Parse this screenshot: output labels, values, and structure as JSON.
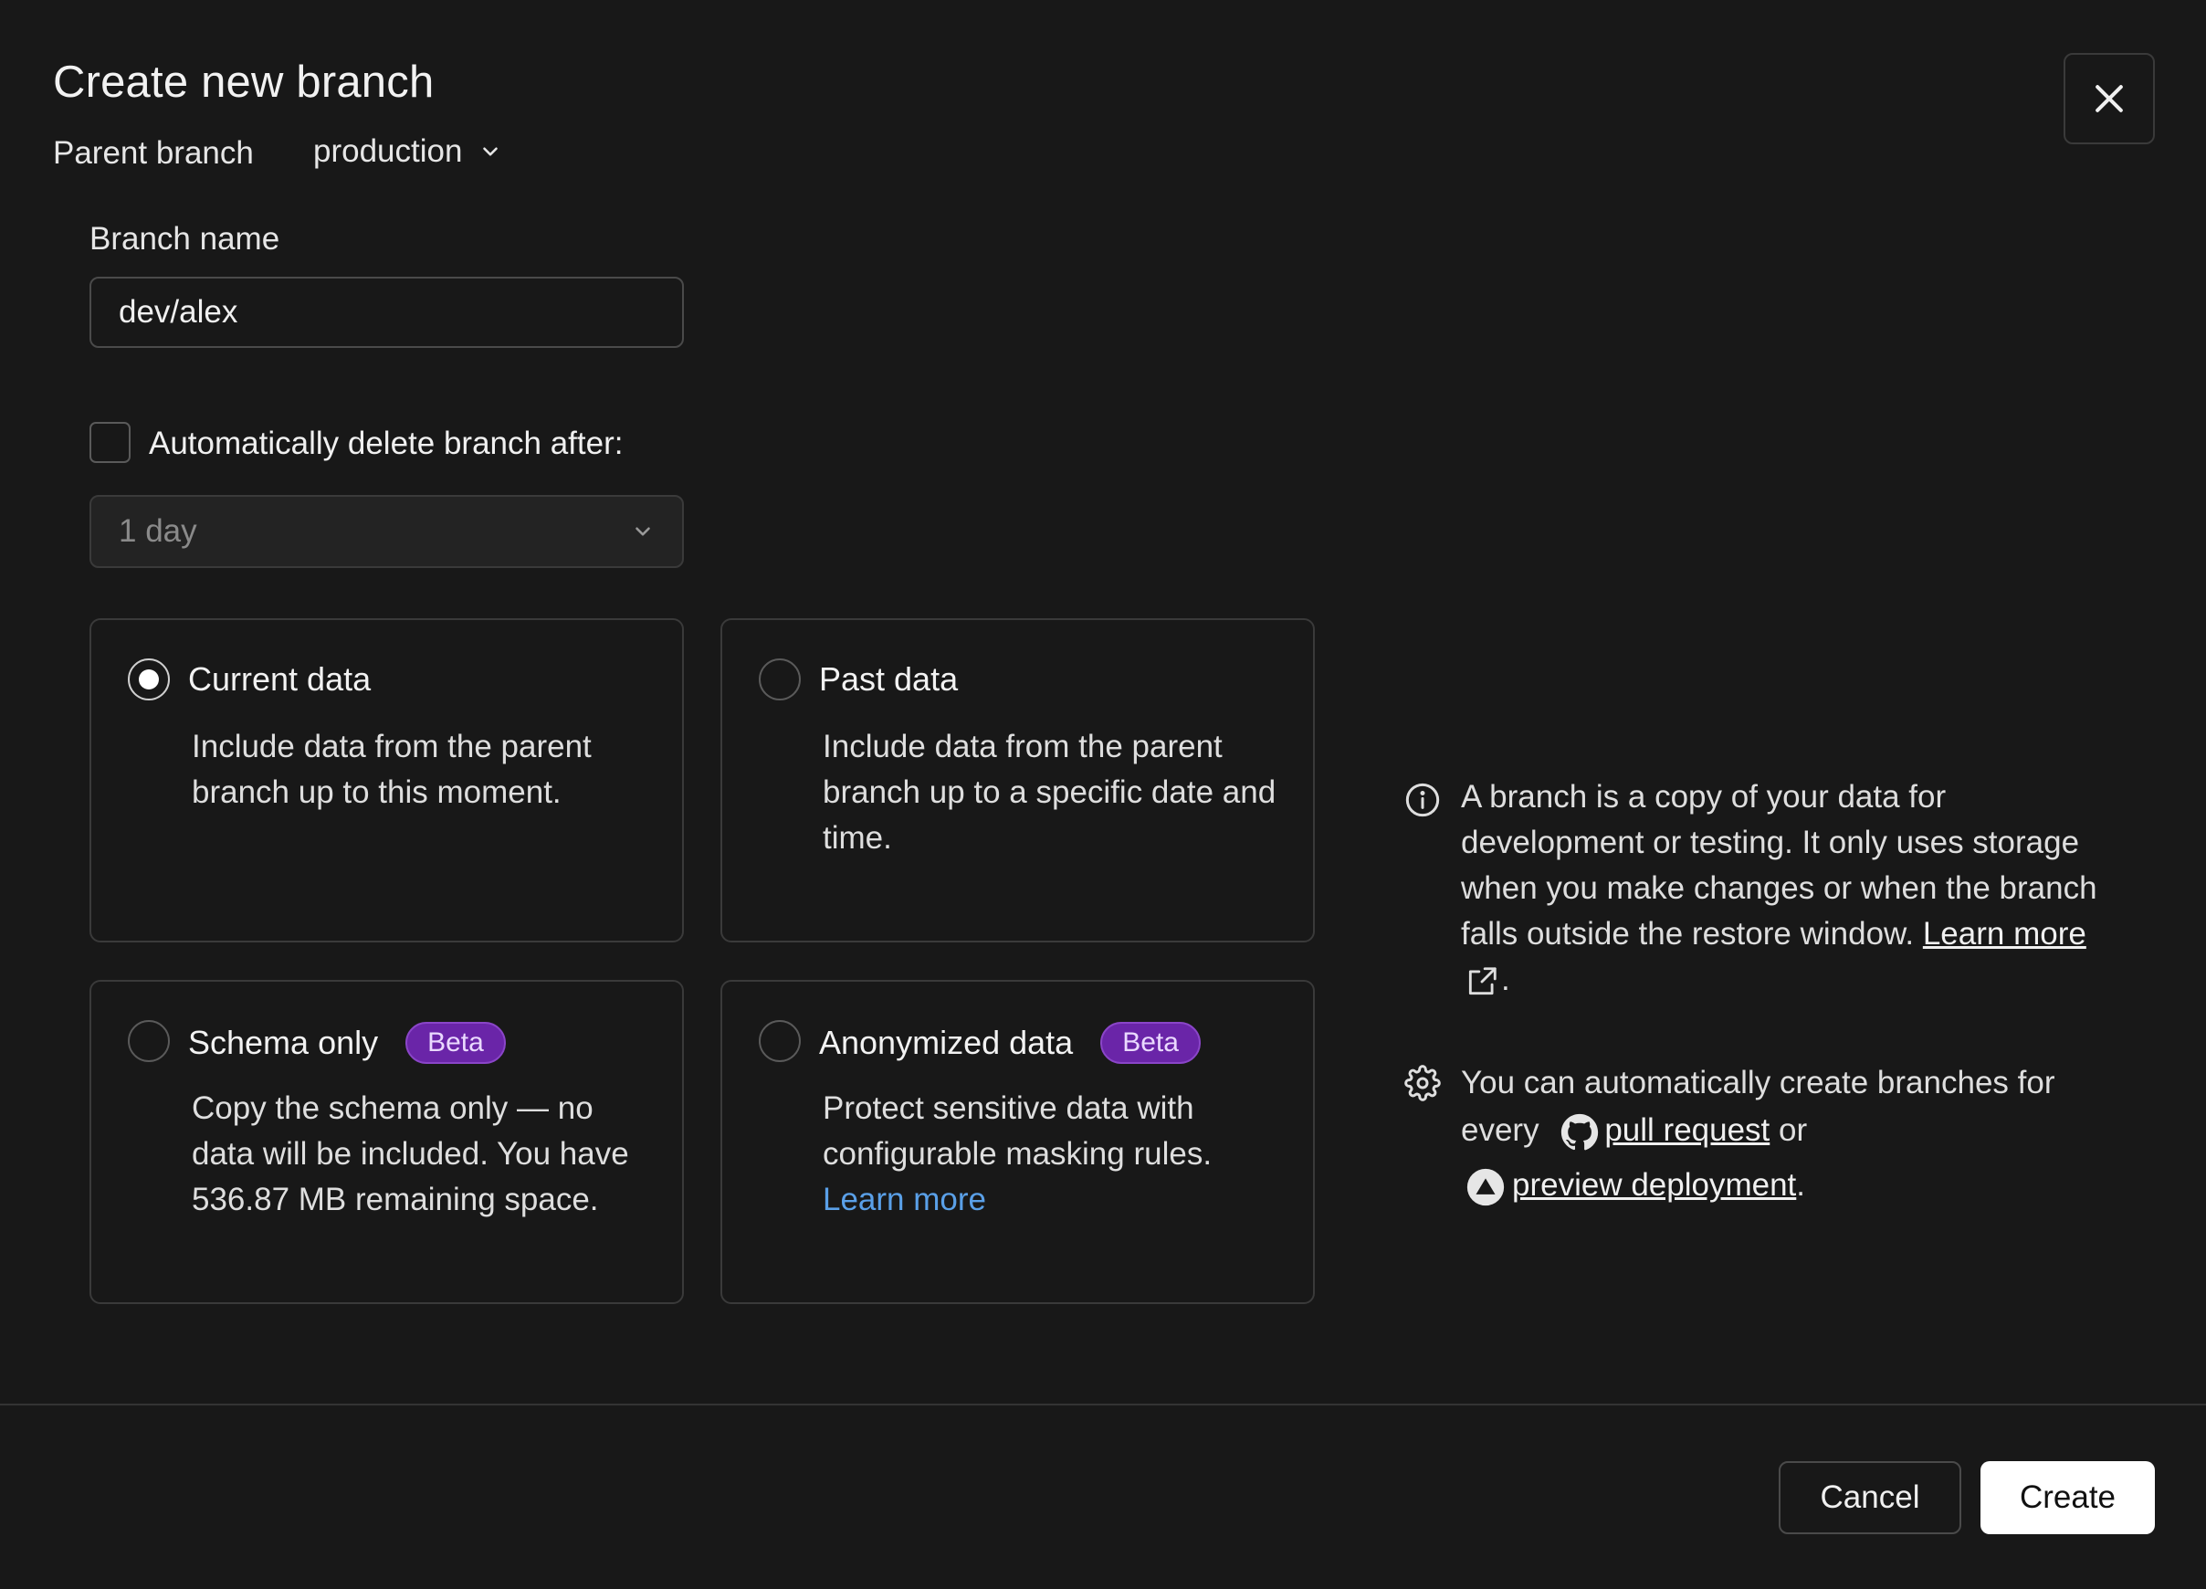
{
  "dialog": {
    "title": "Create new branch",
    "parent_branch_label": "Parent branch",
    "parent_branch_value": "production"
  },
  "form": {
    "branch_name_label": "Branch name",
    "branch_name_value": "dev/alex",
    "auto_delete_label": "Automatically delete branch after:",
    "auto_delete_checked": false,
    "auto_delete_duration": "1 day"
  },
  "options": [
    {
      "title": "Current data",
      "desc": "Include data from the parent branch up to this moment.",
      "selected": true
    },
    {
      "title": "Past data",
      "desc": "Include data from the parent branch up to a specific date and time.",
      "selected": false
    },
    {
      "title": "Schema only",
      "badge": "Beta",
      "desc": "Copy the schema only — no data will be included. You have 536.87 MB remaining space.",
      "selected": false
    },
    {
      "title": "Anonymized data",
      "badge": "Beta",
      "desc": "Protect sensitive data with configurable masking rules.",
      "link": "Learn more",
      "selected": false
    }
  ],
  "info": {
    "text": "A branch is a copy of your data for development or testing. It only uses storage when you make changes or when the branch falls outside the restore window.",
    "link": "Learn more",
    "suffix": "."
  },
  "automation": {
    "text_before": "You can automatically create branches for every",
    "pull_request": "pull request",
    "or": "or",
    "preview_deployment": "preview deployment",
    "suffix": "."
  },
  "footer": {
    "cancel_label": "Cancel",
    "create_label": "Create"
  },
  "icons": {
    "close": "close-icon",
    "chevron": "chevron-down-icon",
    "info": "info-icon",
    "gear": "gear-icon",
    "github": "github-icon",
    "vercel": "vercel-icon",
    "external": "external-link-icon"
  }
}
